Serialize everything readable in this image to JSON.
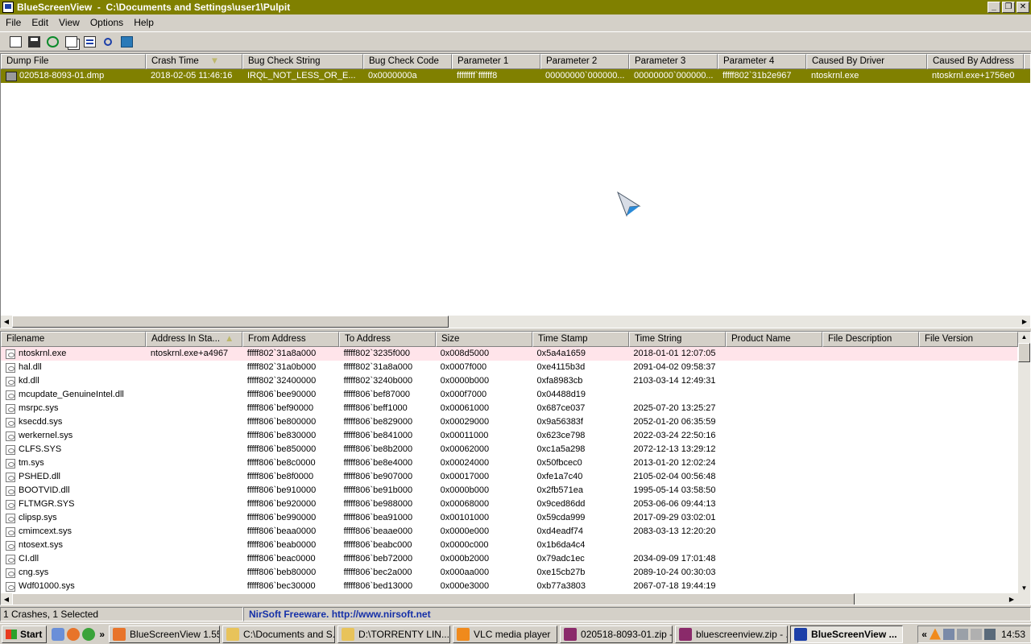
{
  "window": {
    "title": "BlueScreenView  -  C:\\Documents and Settings\\user1\\Pulpit"
  },
  "menu": [
    "File",
    "Edit",
    "View",
    "Options",
    "Help"
  ],
  "toolbar_icons": [
    "save-html-report-icon",
    "save-selected-icon",
    "refresh-icon",
    "copy-icon",
    "properties-icon",
    "find-icon",
    "exit-icon"
  ],
  "crash_table": {
    "columns": [
      "Dump File",
      "Crash Time",
      "Bug Check String",
      "Bug Check Code",
      "Parameter 1",
      "Parameter 2",
      "Parameter 3",
      "Parameter 4",
      "Caused By Driver",
      "Caused By Address"
    ],
    "sorted_column": "Crash Time",
    "rows": [
      [
        "020518-8093-01.dmp",
        "2018-02-05 11:46:16",
        "IRQL_NOT_LESS_OR_E...",
        "0x0000000a",
        "ffffffff`ffffff8",
        "00000000`000000...",
        "00000000`000000...",
        "fffff802`31b2e967",
        "ntoskrnl.exe",
        "ntoskrnl.exe+1756e0"
      ]
    ]
  },
  "driver_table": {
    "columns": [
      "Filename",
      "Address In Sta...",
      "From Address",
      "To Address",
      "Size",
      "Time Stamp",
      "Time String",
      "Product Name",
      "File Description",
      "File Version"
    ],
    "sorted_column": "Address In Sta...",
    "rows": [
      [
        "ntoskrnl.exe",
        "ntoskrnl.exe+a4967",
        "fffff802`31a8a000",
        "fffff802`3235f000",
        "0x008d5000",
        "0x5a4a1659",
        "2018-01-01 12:07:05",
        "",
        "",
        ""
      ],
      [
        "hal.dll",
        "",
        "fffff802`31a0b000",
        "fffff802`31a8a000",
        "0x0007f000",
        "0xe4115b3d",
        "2091-04-02 09:58:37",
        "",
        "",
        ""
      ],
      [
        "kd.dll",
        "",
        "fffff802`32400000",
        "fffff802`3240b000",
        "0x0000b000",
        "0xfa8983cb",
        "2103-03-14 12:49:31",
        "",
        "",
        ""
      ],
      [
        "mcupdate_GenuineIntel.dll",
        "",
        "fffff806`bee90000",
        "fffff806`bef87000",
        "0x000f7000",
        "0x04488d19",
        "",
        "",
        "",
        ""
      ],
      [
        "msrpc.sys",
        "",
        "fffff806`bef90000",
        "fffff806`beff1000",
        "0x00061000",
        "0x687ce037",
        "2025-07-20 13:25:27",
        "",
        "",
        ""
      ],
      [
        "ksecdd.sys",
        "",
        "fffff806`be800000",
        "fffff806`be829000",
        "0x00029000",
        "0x9a56383f",
        "2052-01-20 06:35:59",
        "",
        "",
        ""
      ],
      [
        "werkernel.sys",
        "",
        "fffff806`be830000",
        "fffff806`be841000",
        "0x00011000",
        "0x623ce798",
        "2022-03-24 22:50:16",
        "",
        "",
        ""
      ],
      [
        "CLFS.SYS",
        "",
        "fffff806`be850000",
        "fffff806`be8b2000",
        "0x00062000",
        "0xc1a5a298",
        "2072-12-13 13:29:12",
        "",
        "",
        ""
      ],
      [
        "tm.sys",
        "",
        "fffff806`be8c0000",
        "fffff806`be8e4000",
        "0x00024000",
        "0x50fbcec0",
        "2013-01-20 12:02:24",
        "",
        "",
        ""
      ],
      [
        "PSHED.dll",
        "",
        "fffff806`be8f0000",
        "fffff806`be907000",
        "0x00017000",
        "0xfe1a7c40",
        "2105-02-04 00:56:48",
        "",
        "",
        ""
      ],
      [
        "BOOTVID.dll",
        "",
        "fffff806`be910000",
        "fffff806`be91b000",
        "0x0000b000",
        "0x2fb571ea",
        "1995-05-14 03:58:50",
        "",
        "",
        ""
      ],
      [
        "FLTMGR.SYS",
        "",
        "fffff806`be920000",
        "fffff806`be988000",
        "0x00068000",
        "0x9ced86dd",
        "2053-06-06 09:44:13",
        "",
        "",
        ""
      ],
      [
        "clipsp.sys",
        "",
        "fffff806`be990000",
        "fffff806`bea91000",
        "0x00101000",
        "0x59cda999",
        "2017-09-29 03:02:01",
        "",
        "",
        ""
      ],
      [
        "cmimcext.sys",
        "",
        "fffff806`beaa0000",
        "fffff806`beaae000",
        "0x0000e000",
        "0xd4eadf74",
        "2083-03-13 12:20:20",
        "",
        "",
        ""
      ],
      [
        "ntosext.sys",
        "",
        "fffff806`beab0000",
        "fffff806`beabc000",
        "0x0000c000",
        "0x1b6da4c4",
        "",
        "",
        "",
        ""
      ],
      [
        "CI.dll",
        "",
        "fffff806`beac0000",
        "fffff806`beb72000",
        "0x000b2000",
        "0x79adc1ec",
        "2034-09-09 17:01:48",
        "",
        "",
        ""
      ],
      [
        "cng.sys",
        "",
        "fffff806`beb80000",
        "fffff806`bec2a000",
        "0x000aa000",
        "0xe15cb27b",
        "2089-10-24 00:30:03",
        "",
        "",
        ""
      ],
      [
        "Wdf01000.sys",
        "",
        "fffff806`bec30000",
        "fffff806`bed13000",
        "0x000e3000",
        "0xb77a3803",
        "2067-07-18 19:44:19",
        "",
        "",
        ""
      ]
    ]
  },
  "status": {
    "count": "1 Crashes, 1 Selected",
    "link": "NirSoft Freeware.  http://www.nirsoft.net"
  },
  "taskbar": {
    "start": "Start",
    "tasks": [
      {
        "label": "BlueScreenView 1.55...",
        "icon": "firefox-icon",
        "color": "#e8742a"
      },
      {
        "label": "C:\\Documents and S...",
        "icon": "folder-icon",
        "color": "#e8c35a"
      },
      {
        "label": "D:\\TORRENTY LIN...",
        "icon": "folder-icon",
        "color": "#e8c35a"
      },
      {
        "label": "VLC media player",
        "icon": "vlc-icon",
        "color": "#f08a1c"
      },
      {
        "label": "020518-8093-01.zip - ...",
        "icon": "winrar-icon",
        "color": "#8a2a6a"
      },
      {
        "label": "bluescreenview.zip - ...",
        "icon": "winrar-icon",
        "color": "#8a2a6a"
      },
      {
        "label": "BlueScreenView  ...",
        "icon": "bluescreenview-icon",
        "color": "#1c3fa8"
      }
    ],
    "clock": "14:53"
  },
  "colors": {
    "titlebar": "#808000",
    "selected_row": "#808000",
    "highlight_row": "#ffe4ea",
    "link": "#1530a8"
  }
}
